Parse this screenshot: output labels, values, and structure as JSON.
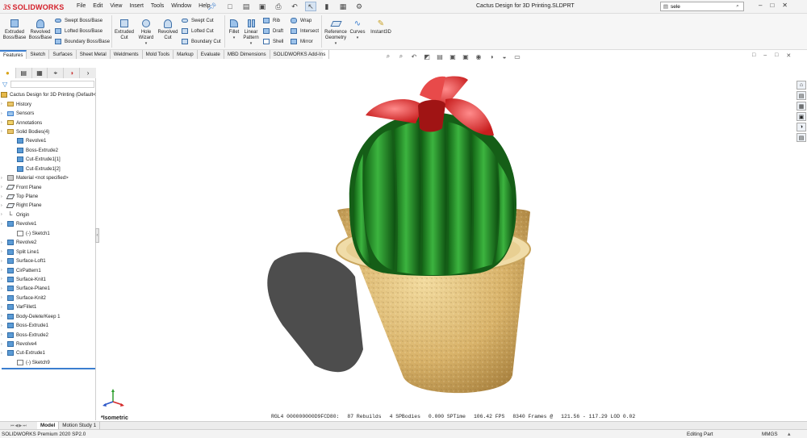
{
  "app": {
    "logo_ds": "3S",
    "logo_text": "SOLIDWORKS",
    "window_title": "Cactus Design for 3D Printing.SLDPRT",
    "search_value": "sele"
  },
  "menu": [
    "File",
    "Edit",
    "View",
    "Insert",
    "Tools",
    "Window",
    "Help"
  ],
  "ribbon": {
    "extruded_boss": "Extruded Boss/Base",
    "revolved_boss": "Revolved Boss/Base",
    "swept_boss": "Swept Boss/Base",
    "lofted_boss": "Lofted Boss/Base",
    "boundary_boss": "Boundary Boss/Base",
    "extruded_cut": "Extruded Cut",
    "hole_wizard": "Hole Wizard",
    "revolved_cut": "Revolved Cut",
    "swept_cut": "Swept Cut",
    "lofted_cut": "Lofted Cut",
    "boundary_cut": "Boundary Cut",
    "fillet": "Fillet",
    "linear_pattern": "Linear Pattern",
    "rib": "Rib",
    "draft": "Draft",
    "shell": "Shell",
    "wrap": "Wrap",
    "intersect": "Intersect",
    "mirror": "Mirror",
    "reference_geometry": "Reference Geometry",
    "curves": "Curves",
    "instant3d": "Instant3D"
  },
  "tabs": [
    "Features",
    "Sketch",
    "Surfaces",
    "Sheet Metal",
    "Weldments",
    "Mold Tools",
    "Markup",
    "Evaluate",
    "MBD Dimensions",
    "SOLIDWORKS Add-Ins"
  ],
  "tree": {
    "root": "Cactus Design for 3D Printing  (Default<",
    "items": [
      {
        "label": "History",
        "level": 0,
        "icon": "folder"
      },
      {
        "label": "Sensors",
        "level": 0,
        "icon": "sensor"
      },
      {
        "label": "Annotations",
        "level": 0,
        "icon": "annotation"
      },
      {
        "label": "Solid Bodies(4)",
        "level": 0,
        "icon": "folder"
      },
      {
        "label": "Revolve1",
        "level": 1,
        "icon": "body"
      },
      {
        "label": "Boss-Extrude2",
        "level": 1,
        "icon": "body"
      },
      {
        "label": "Cut-Extrude1[1]",
        "level": 1,
        "icon": "body"
      },
      {
        "label": "Cut-Extrude1[2]",
        "level": 1,
        "icon": "body"
      },
      {
        "label": "Material <not specified>",
        "level": 0,
        "icon": "material"
      },
      {
        "label": "Front Plane",
        "level": 0,
        "icon": "plane"
      },
      {
        "label": "Top Plane",
        "level": 0,
        "icon": "plane"
      },
      {
        "label": "Right Plane",
        "level": 0,
        "icon": "plane"
      },
      {
        "label": "Origin",
        "level": 0,
        "icon": "origin"
      },
      {
        "label": "Revolve1",
        "level": 0,
        "icon": "feature"
      },
      {
        "label": "(-) Sketch1",
        "level": 2,
        "icon": "sketch"
      },
      {
        "label": "Revolve2",
        "level": 0,
        "icon": "feature"
      },
      {
        "label": "Split Line1",
        "level": 0,
        "icon": "feature"
      },
      {
        "label": "Surface-Loft1",
        "level": 0,
        "icon": "feature"
      },
      {
        "label": "CirPattern1",
        "level": 0,
        "icon": "feature"
      },
      {
        "label": "Surface-Knit1",
        "level": 0,
        "icon": "feature"
      },
      {
        "label": "Surface-Plane1",
        "level": 0,
        "icon": "feature"
      },
      {
        "label": "Surface-Knit2",
        "level": 0,
        "icon": "feature"
      },
      {
        "label": "VarFillet1",
        "level": 0,
        "icon": "feature"
      },
      {
        "label": "Body-Delete/Keep 1",
        "level": 0,
        "icon": "feature"
      },
      {
        "label": "Boss-Extrude1",
        "level": 0,
        "icon": "feature"
      },
      {
        "label": "Boss-Extrude2",
        "level": 0,
        "icon": "feature"
      },
      {
        "label": "Revolve4",
        "level": 0,
        "icon": "feature"
      },
      {
        "label": "Cut-Extrude1",
        "level": 0,
        "icon": "feature"
      },
      {
        "label": "(-) Sketch9",
        "level": 2,
        "icon": "sketch"
      }
    ]
  },
  "viewport": {
    "view_label": "*Isometric",
    "renderer": "RGL4 000000000D9FCD80:",
    "rebuilds": "87 Rebuilds",
    "bodies": "4 SPBodies",
    "sptime": "0.000 SPTime",
    "fps": "106.42 FPS",
    "frames": "8340 Frames @",
    "resolution": "121.56 - 117.29 LOD 0.02"
  },
  "bottom_tabs": [
    "Model",
    "Motion Study 1"
  ],
  "status": {
    "left": "SOLIDWORKS Premium 2020 SP2.0",
    "mode": "Editing Part",
    "units": "MMGS"
  },
  "colors": {
    "accent": "#3b7ecf",
    "brand": "#d4202a",
    "cactus_green": "#1f8a22",
    "pot": "#d9b773",
    "flower": "#e03a3a"
  }
}
